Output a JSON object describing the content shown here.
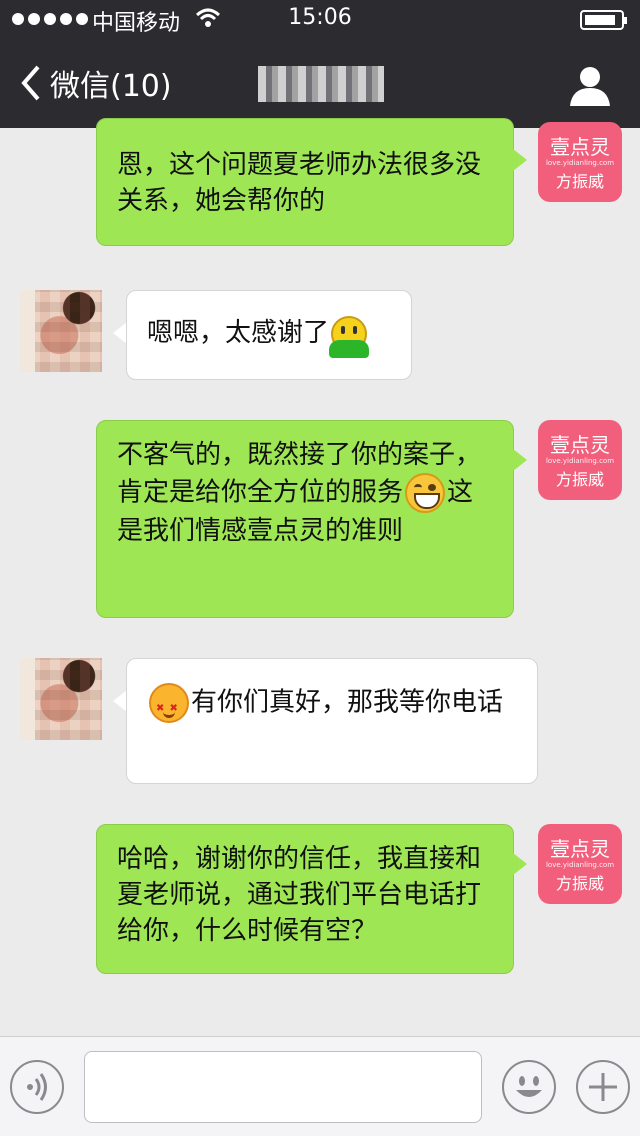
{
  "status_bar": {
    "carrier": "中国移动",
    "time": "15:06"
  },
  "nav": {
    "back_label": "微信(10)",
    "title": ""
  },
  "brand_badge": {
    "line1": "壹点灵",
    "url": "love.yidianling.com",
    "line2": "方振威"
  },
  "messages": [
    {
      "side": "outgoing",
      "text": "恩，这个问题夏老师办法很多没关系，她会帮你的"
    },
    {
      "side": "incoming",
      "text": "嗯嗯，太感谢了",
      "emoji": "green-person-emoji"
    },
    {
      "side": "outgoing",
      "text_before": "不客气的，既然接了你的案子，肯定是给你全方位的服务",
      "emoji": "grin-emoji",
      "text_after": "这是我们情感壹点灵的准则"
    },
    {
      "side": "incoming",
      "emoji": "love-emoji",
      "text": "有你们真好，那我等你电话"
    },
    {
      "side": "outgoing",
      "text": "哈哈，谢谢你的信任，我直接和夏老师说，通过我们平台电话打给你，什么时候有空？"
    }
  ],
  "input_bar": {
    "text": "",
    "icons": [
      "voice-icon",
      "emoji-icon",
      "plus-icon"
    ]
  }
}
